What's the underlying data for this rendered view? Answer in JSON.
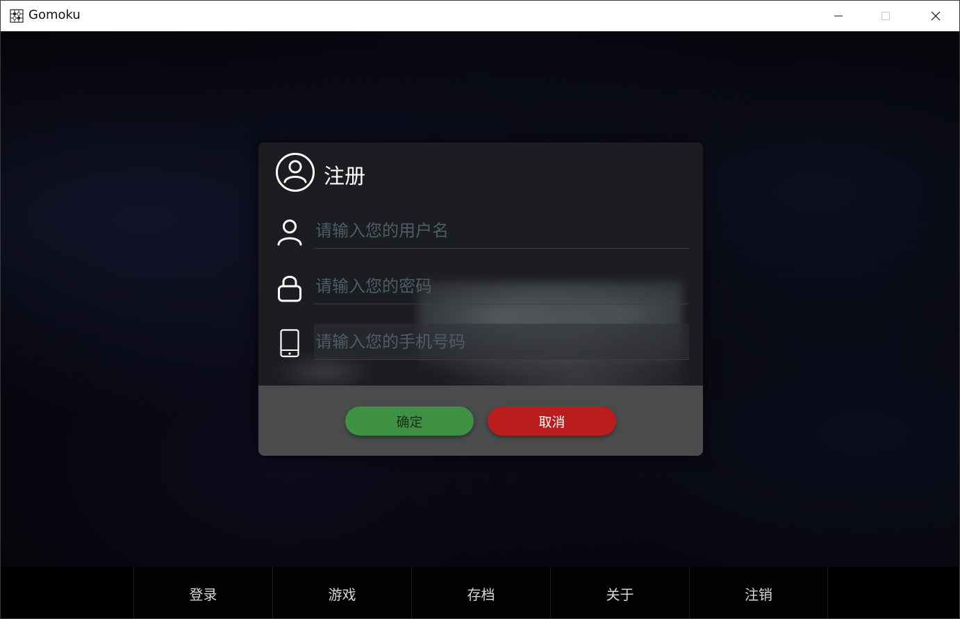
{
  "window": {
    "title": "Gomoku"
  },
  "dialog": {
    "title": "注册",
    "fields": [
      {
        "icon": "user-icon",
        "placeholder": "请输入您的用户名",
        "value": ""
      },
      {
        "icon": "lock-icon",
        "placeholder": "请输入您的密码",
        "value": ""
      },
      {
        "icon": "phone-icon",
        "placeholder": "请输入您的手机号码",
        "value": ""
      }
    ],
    "confirm_label": "确定",
    "cancel_label": "取消"
  },
  "nav": {
    "items": [
      {
        "label": "登录"
      },
      {
        "label": "游戏"
      },
      {
        "label": "存档"
      },
      {
        "label": "关于"
      },
      {
        "label": "注销"
      }
    ]
  },
  "colors": {
    "confirm": "#3e9043",
    "cancel": "#bb1d1d",
    "dialog_bg": "#1c1d20",
    "button_bar_bg": "#4a4b4d"
  }
}
